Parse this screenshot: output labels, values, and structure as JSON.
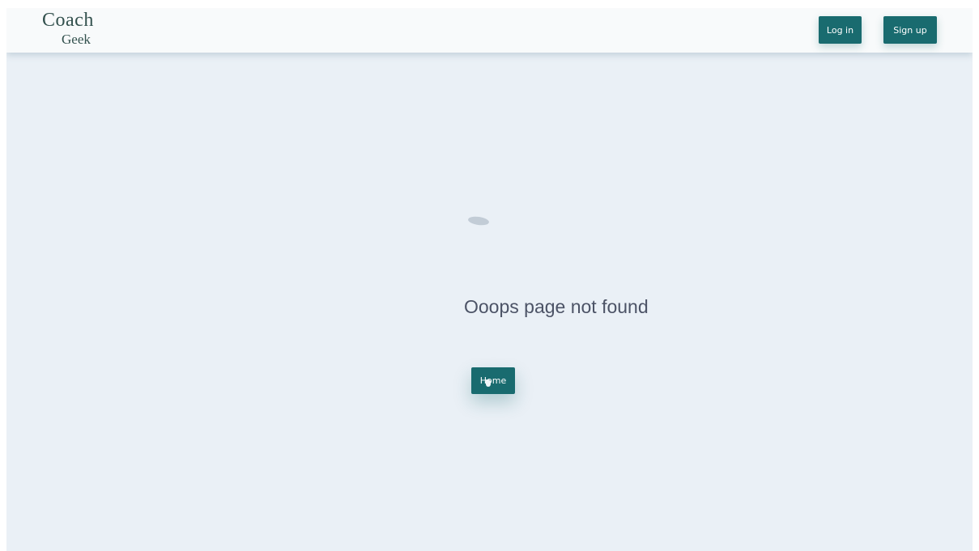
{
  "header": {
    "logo": {
      "line1": "Coach",
      "line2": "Geek"
    },
    "login_label": "Log in",
    "signup_label": "Sign up"
  },
  "main": {
    "message": "Ooops page not found",
    "home_label": "Home"
  },
  "colors": {
    "background": "#eaf0f6",
    "navbar": "#f8fafb",
    "accent": "#196b6f",
    "text": "#4c5366",
    "logo": "#33514e"
  }
}
